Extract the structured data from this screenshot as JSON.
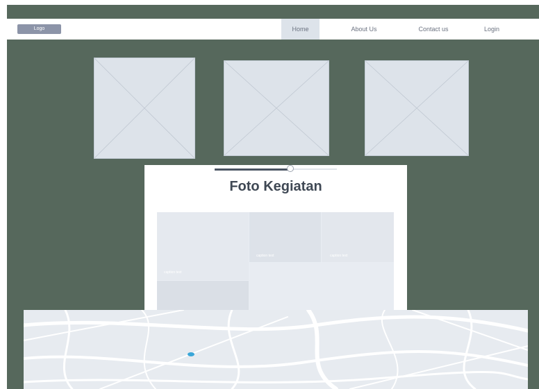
{
  "navbar": {
    "logo": "Logo",
    "items": [
      {
        "label": "Home",
        "active": true
      },
      {
        "label": "About Us",
        "active": false
      },
      {
        "label": "Contact us",
        "active": false
      },
      {
        "label": "Login",
        "active": false
      }
    ]
  },
  "placeholders": [
    {
      "icon": "image-placeholder-icon"
    },
    {
      "icon": "image-placeholder-icon"
    },
    {
      "icon": "image-placeholder-icon"
    }
  ],
  "gallery_card": {
    "title": "Foto Kegiatan",
    "slider_value": 0.62,
    "captions": [
      "caption text",
      "caption text",
      "caption text"
    ]
  },
  "map": {
    "marker_icon": "location-dot-icon"
  },
  "colors": {
    "background": "#56685c",
    "navbar": "#ffffff",
    "nav_active": "#dde3ea",
    "logo": "#8c94a8",
    "placeholder": "#dde3ea",
    "marker": "#3aa6d8"
  }
}
